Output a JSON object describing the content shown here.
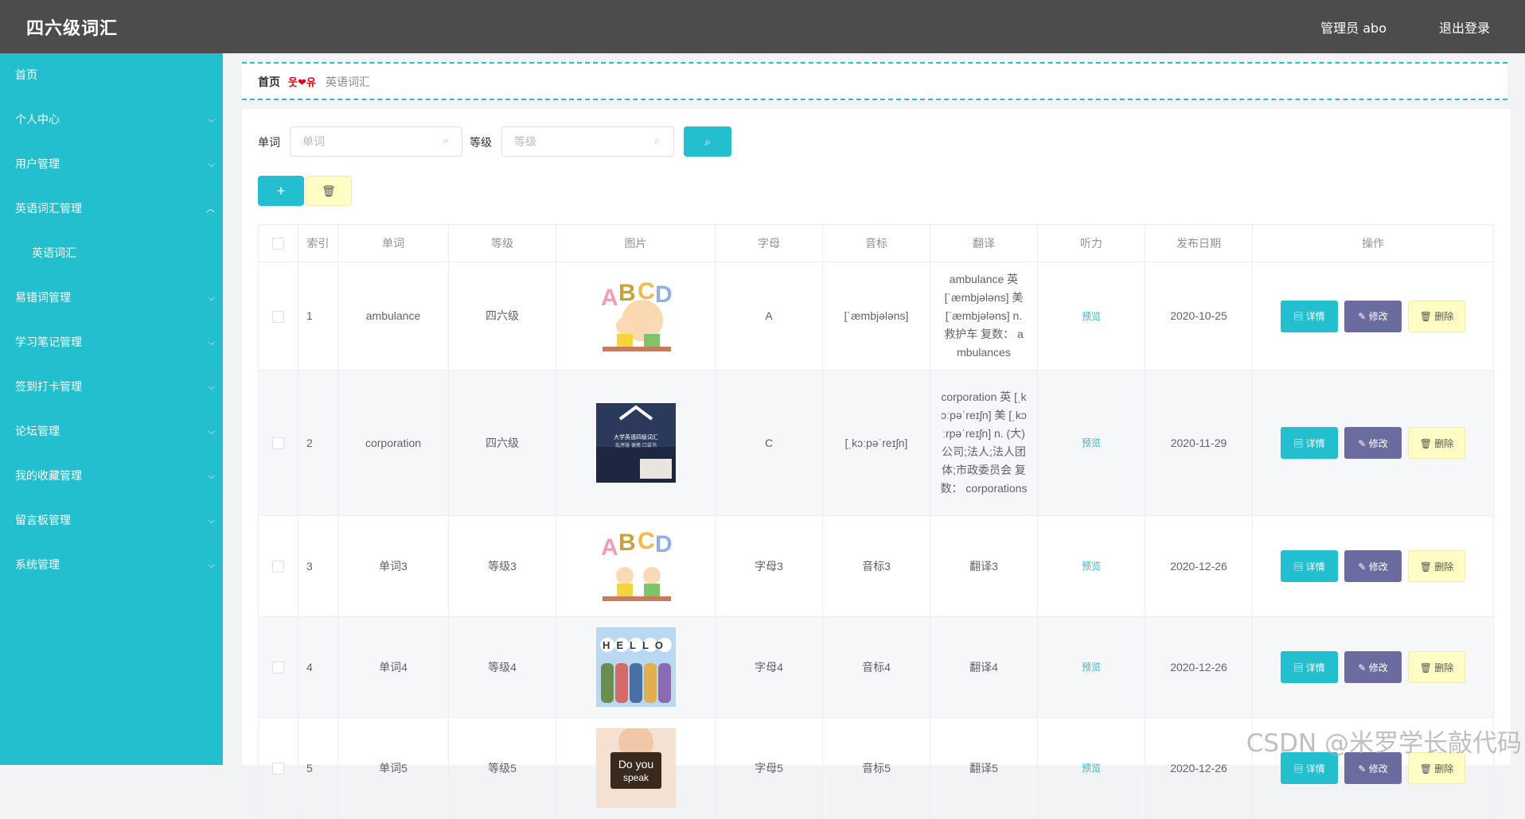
{
  "app": {
    "title": "四六级词汇"
  },
  "header": {
    "user": "管理员 abo",
    "logout": "退出登录"
  },
  "sidebar": {
    "items": [
      {
        "label": "首页",
        "chevron": ""
      },
      {
        "label": "个人中心",
        "chevron": "⌵"
      },
      {
        "label": "用户管理",
        "chevron": "⌵"
      },
      {
        "label": "英语词汇管理",
        "chevron": "︿"
      },
      {
        "label": "易错词管理",
        "chevron": "⌵"
      },
      {
        "label": "学习笔记管理",
        "chevron": "⌵"
      },
      {
        "label": "签到打卡管理",
        "chevron": "⌵"
      },
      {
        "label": "论坛管理",
        "chevron": "⌵"
      },
      {
        "label": "我的收藏管理",
        "chevron": "⌵"
      },
      {
        "label": "留言板管理",
        "chevron": "⌵"
      },
      {
        "label": "系统管理",
        "chevron": "⌵"
      }
    ],
    "sub": {
      "label": "英语词汇"
    }
  },
  "breadcrumb": {
    "home": "首页",
    "sep": "웃❤유",
    "current": "英语词汇"
  },
  "search": {
    "word_label": "单词",
    "word_placeholder": "单词",
    "level_label": "等级",
    "level_placeholder": "等级",
    "button_icon": "search-icon"
  },
  "toolbar": {
    "add_label": "+",
    "delete_icon": "trash-icon"
  },
  "table": {
    "headers": {
      "index": "索引",
      "word": "单词",
      "level": "等级",
      "image": "图片",
      "letter": "字母",
      "phonetic": "音标",
      "translation": "翻译",
      "listening": "听力",
      "date": "发布日期",
      "ops": "操作"
    },
    "preview_label": "预览",
    "detail_label": "详情",
    "edit_label": "修改",
    "delete_label": "删除",
    "rows": [
      {
        "index": "1",
        "word": "ambulance",
        "level": "四六级",
        "image": "abcd-kids-image",
        "letter": "A",
        "phonetic": "[ˈæmbjələns]",
        "translation": "ambulance 英 [ˈæmbjələns] 美 [ˈæmbjələns] n. 救护车 复数： ambulances",
        "date": "2020-10-25"
      },
      {
        "index": "2",
        "word": "corporation",
        "level": "四六级",
        "image": "book-cover-image",
        "letter": "C",
        "phonetic": "[ˌkɔːpəˈreɪʃn]",
        "translation": "corporation 英 [ˌkɔːpəˈreɪʃn] 美 [ˌkɔːrpəˈreɪʃn] n. (大)公司;法人;法人团体;市政委员会 复数： corporations",
        "date": "2020-11-29"
      },
      {
        "index": "3",
        "word": "单词3",
        "level": "等级3",
        "image": "abcd-kids-image",
        "letter": "字母3",
        "phonetic": "音标3",
        "translation": "翻译3",
        "date": "2020-12-26"
      },
      {
        "index": "4",
        "word": "单词4",
        "level": "等级4",
        "image": "hello-kids-image",
        "letter": "字母4",
        "phonetic": "音标4",
        "translation": "翻译4",
        "date": "2020-12-26"
      },
      {
        "index": "5",
        "word": "单词5",
        "level": "等级5",
        "image": "do-you-speak-image",
        "letter": "字母5",
        "phonetic": "音标5",
        "translation": "翻译5",
        "date": "2020-12-26"
      }
    ]
  },
  "image_text": {
    "book_line1": "大学英语四级词汇",
    "book_line2": "乱序版 便携 口袋书",
    "hello": "HELLO",
    "doyou": "Do you",
    "speak": "speak"
  },
  "watermark": "CSDN @米罗学长敲代码",
  "colors": {
    "accent": "#24bfcf",
    "header_bg": "#4c4c4c",
    "edit_btn": "#6a6c9f",
    "delete_btn": "#fffcc4"
  }
}
